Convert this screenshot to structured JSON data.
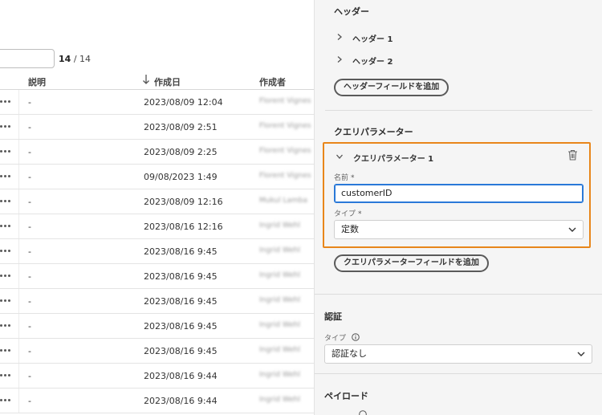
{
  "pagination": {
    "current": "14",
    "total": "/ 14"
  },
  "table": {
    "columns": {
      "description": "説明",
      "created": "作成日",
      "creator": "作成者"
    },
    "rows": [
      {
        "description": "-",
        "created": "2023/08/09 12:04",
        "creator": "Florent Vignes"
      },
      {
        "description": "-",
        "created": "2023/08/09 2:51",
        "creator": "Florent Vignes"
      },
      {
        "description": "-",
        "created": "2023/08/09 2:25",
        "creator": "Florent Vignes"
      },
      {
        "description": "-",
        "created": "09/08/2023 1:49",
        "creator": "Florent Vignes"
      },
      {
        "description": "-",
        "created": "2023/08/09 12:16",
        "creator": "Mukul Lamba"
      },
      {
        "description": "-",
        "created": "2023/08/16 12:16",
        "creator": "Ingrid Wehl"
      },
      {
        "description": "-",
        "created": "2023/08/16 9:45",
        "creator": "Ingrid Wehl"
      },
      {
        "description": "-",
        "created": "2023/08/16 9:45",
        "creator": "Ingrid Wehl"
      },
      {
        "description": "-",
        "created": "2023/08/16 9:45",
        "creator": "Ingrid Wehl"
      },
      {
        "description": "-",
        "created": "2023/08/16 9:45",
        "creator": "Ingrid Wehl"
      },
      {
        "description": "-",
        "created": "2023/08/16 9:45",
        "creator": "Ingrid Wehl"
      },
      {
        "description": "-",
        "created": "2023/08/16 9:44",
        "creator": "Ingrid Wehl"
      },
      {
        "description": "-",
        "created": "2023/08/16 9:44",
        "creator": "Ingrid Wehl"
      }
    ]
  },
  "panel": {
    "headers": {
      "title": "ヘッダー",
      "items": [
        "ヘッダー 1",
        "ヘッダー 2"
      ],
      "add_button": "ヘッダーフィールドを追加"
    },
    "query": {
      "title": "クエリパラメーター",
      "item_title": "クエリパラメーター 1",
      "name_label": "名前",
      "name_value": "customerID",
      "type_label": "タイプ",
      "type_value": "定数",
      "required_mark": "*",
      "add_button": "クエリパラメーターフィールドを追加"
    },
    "auth": {
      "title": "認証",
      "type_label": "タイプ",
      "type_value": "認証なし"
    },
    "payload": {
      "title": "ペイロード"
    }
  },
  "colors": {
    "highlight": "#e8861a",
    "focus": "#2a79d8",
    "panel_bg": "#f5f5f5"
  },
  "icons": [
    "more-icon",
    "sort-down-icon",
    "chevron-right-icon",
    "chevron-down-icon",
    "trash-icon",
    "info-icon",
    "dropdown-icon"
  ]
}
